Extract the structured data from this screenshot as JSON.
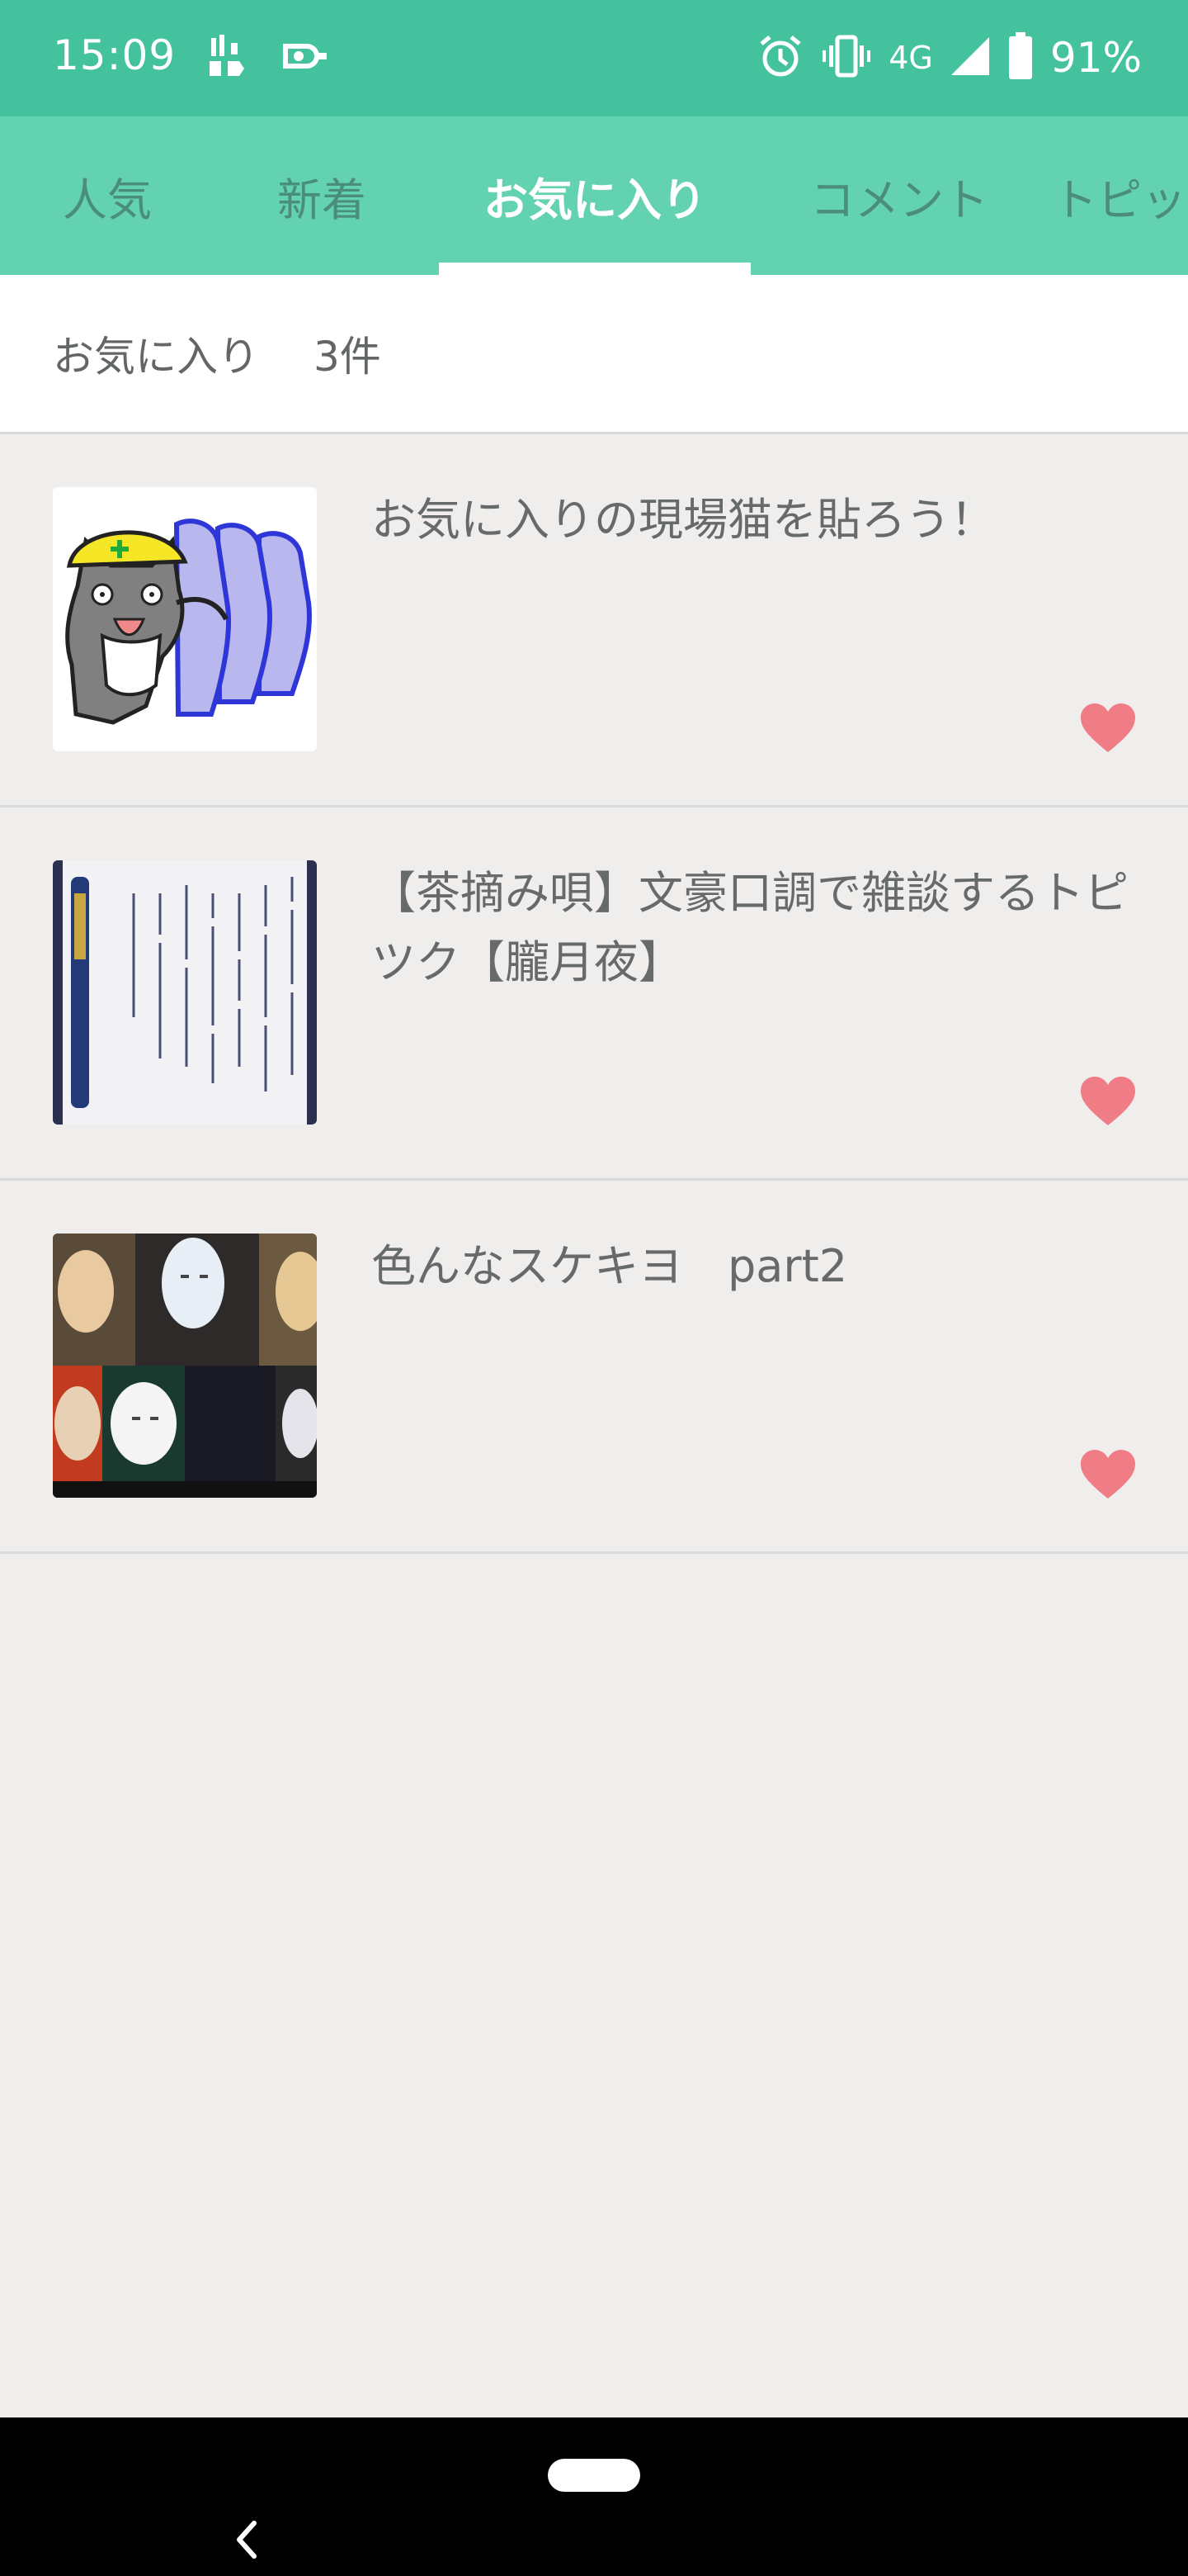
{
  "status_bar": {
    "time": "15:09",
    "network": "4G",
    "battery": "91%",
    "icons": [
      "data-saver-icon",
      "cast-icon",
      "alarm-icon",
      "vibrate-icon",
      "signal-icon",
      "battery-icon"
    ]
  },
  "tabs": [
    {
      "label": "人気",
      "active": false
    },
    {
      "label": "新着",
      "active": false
    },
    {
      "label": "お気に入り",
      "active": true
    },
    {
      "label": "コメント",
      "active": false
    },
    {
      "label": "トピック",
      "active": false
    }
  ],
  "favorites_header": {
    "label": "お気に入り",
    "count": "3件"
  },
  "items": [
    {
      "title": "お気に入りの現場猫を貼ろう！",
      "favorited": true,
      "thumbnail": "site-cat-illustration"
    },
    {
      "title": "【茶摘み唄】文豪口調で雑談するトピツク【朧月夜】",
      "favorited": true,
      "thumbnail": "handwritten-poem-with-pen"
    },
    {
      "title": "色んなスケキヨ　part2",
      "favorited": true,
      "thumbnail": "white-masks-collage"
    }
  ],
  "colors": {
    "status_bar": "#43c29d",
    "tab_bar": "#63d2b0",
    "heart": "#f07c86",
    "background": "#efeeed"
  }
}
